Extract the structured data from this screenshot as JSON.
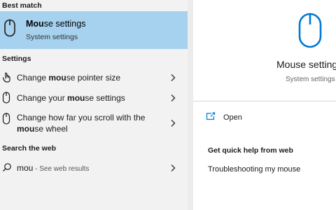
{
  "left": {
    "best_match_header": "Best match",
    "best_match": {
      "title_bold": "Mou",
      "title_rest": "se settings",
      "subtitle": "System settings",
      "icon": "mouse-icon"
    },
    "settings_header": "Settings",
    "settings_items": [
      {
        "pre": "Change ",
        "bold": "mou",
        "post": "se pointer size",
        "icon": "pointer-icon"
      },
      {
        "pre": "Change your ",
        "bold": "mou",
        "post": "se settings",
        "icon": "mouse-icon"
      },
      {
        "line1": "Change how far you scroll with the",
        "bold": "mou",
        "post": "se wheel",
        "icon": "mouse-icon"
      }
    ],
    "web_header": "Search the web",
    "web_item": {
      "bold": "mou",
      "hint": " - See web results",
      "icon": "search-icon"
    }
  },
  "right": {
    "title": "Mouse settings",
    "subtitle": "System settings",
    "open_label": "Open",
    "help_header": "Get quick help from web",
    "help_links": [
      "Troubleshooting my mouse"
    ]
  },
  "colors": {
    "selection": "#a6d1ef",
    "accent": "#0078d4"
  }
}
